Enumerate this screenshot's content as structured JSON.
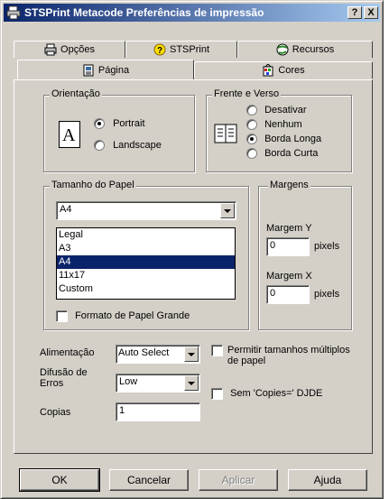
{
  "window": {
    "title": "STSPrint Metacode Preferências de impressão",
    "help_label": "?",
    "close_label": "X"
  },
  "tabs": {
    "row1": [
      {
        "label": "Opções",
        "icon": "printer-icon"
      },
      {
        "label": "STSPrint",
        "icon": "help-icon"
      },
      {
        "label": "Recursos",
        "icon": "globe-icon"
      }
    ],
    "row2": [
      {
        "label": "Página",
        "icon": "page-icon",
        "selected": true
      },
      {
        "label": "Cores",
        "icon": "colors-icon"
      }
    ]
  },
  "orientation": {
    "title": "Orientação",
    "portrait": "Portrait",
    "landscape": "Landscape",
    "selected": "Portrait",
    "glyph": "A"
  },
  "duplex": {
    "title": "Frente e Verso",
    "options": [
      "Desativar",
      "Nenhum",
      "Borda Longa",
      "Borda Curta"
    ],
    "selected": "Borda Longa"
  },
  "paper_size": {
    "title": "Tamanho do Papel",
    "value": "A4",
    "options": [
      "Legal",
      "A3",
      "A4",
      "11x17",
      "Custom"
    ],
    "highlighted": "A4",
    "large_format_label": "Formato de Papel Grande"
  },
  "margins": {
    "title": "Margens",
    "y_label": "Margem Y",
    "y_value": "0",
    "x_label": "Margem X",
    "x_value": "0",
    "unit": "pixels"
  },
  "feed": {
    "label": "Alimentação",
    "value": "Auto Select"
  },
  "diffusion": {
    "label": "Difusão de Erros",
    "value": "Low"
  },
  "copies": {
    "label": "Copias",
    "value": "1"
  },
  "options": {
    "multi_sizes": "Permitir tamanhos múltiplos de papel",
    "no_copies": "Sem 'Copies=' DJDE"
  },
  "buttons": {
    "ok": "OK",
    "cancel": "Cancelar",
    "apply": "Aplicar",
    "help": "Ajuda"
  },
  "colors": {
    "title_start": "#0a246a",
    "title_end": "#a6caf0",
    "face": "#d4d0c8",
    "highlight": "#0a246a"
  }
}
